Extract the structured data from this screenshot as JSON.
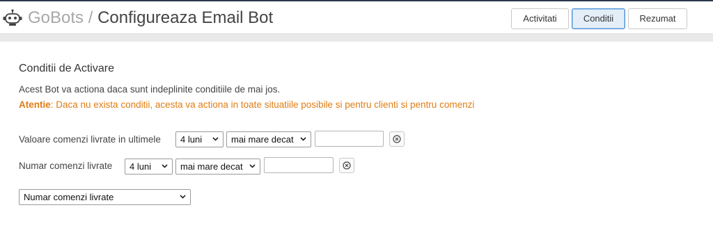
{
  "header": {
    "brand": "GoBots",
    "separator": " / ",
    "page_title": "Configureaza Email Bot",
    "tabs": [
      {
        "label": "Activitati",
        "active": false
      },
      {
        "label": "Conditii",
        "active": true
      },
      {
        "label": "Rezumat",
        "active": false
      }
    ],
    "logo_icon": "robot-icon"
  },
  "section": {
    "title": "Conditii de Activare",
    "description": "Acest Bot va actiona daca sunt indeplinite conditiile de mai jos.",
    "warning_label": "Atentie",
    "warning_text": ": Daca nu exista conditii, acesta va actiona in toate situatiile posibile si pentru clienti si pentru comenzi"
  },
  "conditions": [
    {
      "label": "Valoare comenzi livrate in ultimele",
      "period": "4 luni",
      "operator": "mai mare decat",
      "value": "",
      "remove_icon": "clear-circle-icon"
    },
    {
      "label": "Numar comenzi livrate",
      "period": "4 luni",
      "operator": "mai mare decat",
      "value": "",
      "remove_icon": "clear-circle-icon"
    }
  ],
  "add_condition_select": {
    "selected": "Numar comenzi livrate"
  },
  "colors": {
    "warning": "#e07c12",
    "active_tab_bg": "#e3eef8",
    "active_tab_border": "#4a90d9",
    "topline": "#2b3a4a"
  }
}
